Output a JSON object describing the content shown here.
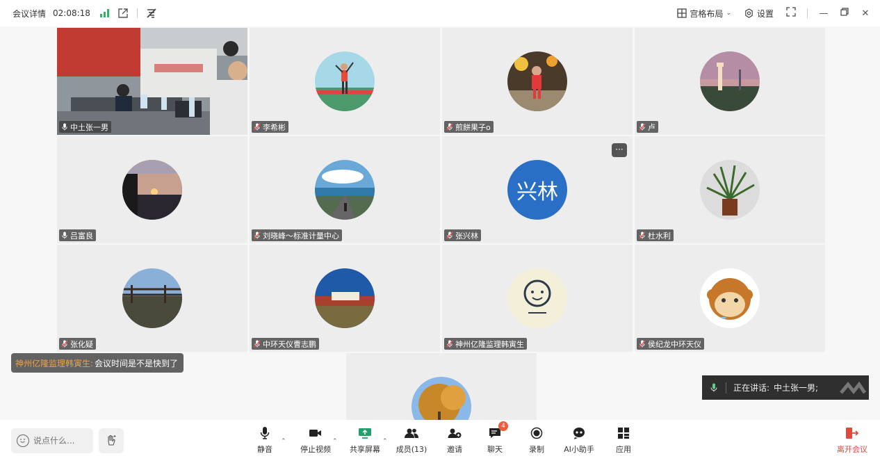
{
  "topbar": {
    "title": "会议详情",
    "timer": "02:08:18",
    "layout_label": "宫格布局",
    "settings_label": "设置"
  },
  "tiles": [
    {
      "name": "中土张一男",
      "mic": "on"
    },
    {
      "name": "李希彬",
      "mic": "muted"
    },
    {
      "name": "煎餅果子o",
      "mic": "muted"
    },
    {
      "name": "卢",
      "mic": "muted"
    },
    {
      "name": "吕富良",
      "mic": "on"
    },
    {
      "name": "刘晓峰～标准计量中心",
      "mic": "muted"
    },
    {
      "name": "张兴林",
      "mic": "muted",
      "avatar_text": "兴林"
    },
    {
      "name": "杜水利",
      "mic": "muted"
    },
    {
      "name": "张化疑",
      "mic": "muted"
    },
    {
      "name": "中环天仪曹志鹏",
      "mic": "muted"
    },
    {
      "name": "神州亿隆监理韩寅生",
      "mic": "muted"
    },
    {
      "name": "侯纪龙中环天仪",
      "mic": "muted"
    }
  ],
  "chat_toast": {
    "sender": "神州亿隆监理韩寅生:",
    "message": "会议时间是不是快到了"
  },
  "speaking": {
    "label": "正在讲话:",
    "name": "中土张一男;"
  },
  "bottombar": {
    "say_placeholder": "说点什么...",
    "mute": "静音",
    "stop_video": "停止视频",
    "share_screen": "共享屏幕",
    "members": "成员(13)",
    "invite": "邀请",
    "chat": "聊天",
    "chat_badge": "4",
    "record": "录制",
    "ai_assistant": "AI小助手",
    "apps": "应用",
    "leave": "离开会议"
  },
  "colors": {
    "active_border": "#3fbf7f",
    "signal": "#34b263",
    "leave": "#e5483a",
    "share": "#22a06b",
    "badge": "#f05b3a",
    "avatar_blue": "#2a6fc6"
  }
}
